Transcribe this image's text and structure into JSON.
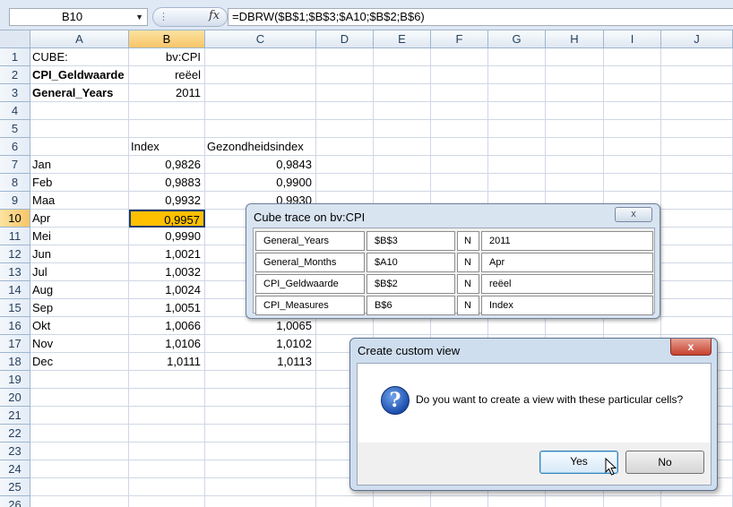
{
  "formula_bar": {
    "name_box": "B10",
    "fx_label": "fx",
    "formula": "=DBRW($B$1;$B$3;$A10;$B$2;B$6)"
  },
  "columns": [
    "A",
    "B",
    "C",
    "D",
    "E",
    "F",
    "G",
    "H",
    "I",
    "J"
  ],
  "rows": [
    {
      "n": "1",
      "a": "CUBE:",
      "b": "bv:CPI",
      "c": ""
    },
    {
      "n": "2",
      "a": "CPI_Geldwaarde",
      "b": "reëel",
      "c": ""
    },
    {
      "n": "3",
      "a": "General_Years",
      "b": "2011",
      "c": ""
    },
    {
      "n": "4",
      "a": "",
      "b": "",
      "c": ""
    },
    {
      "n": "5",
      "a": "",
      "b": "",
      "c": ""
    },
    {
      "n": "6",
      "a": "",
      "b": "Index",
      "c": "Gezondheidsindex"
    },
    {
      "n": "7",
      "a": "Jan",
      "b": "0,9826",
      "c": "0,9843"
    },
    {
      "n": "8",
      "a": "Feb",
      "b": "0,9883",
      "c": "0,9900"
    },
    {
      "n": "9",
      "a": "Maa",
      "b": "0,9932",
      "c": "0,9930"
    },
    {
      "n": "10",
      "a": "Apr",
      "b": "0,9957",
      "c": ""
    },
    {
      "n": "11",
      "a": "Mei",
      "b": "0,9990",
      "c": ""
    },
    {
      "n": "12",
      "a": "Jun",
      "b": "1,0021",
      "c": ""
    },
    {
      "n": "13",
      "a": "Jul",
      "b": "1,0032",
      "c": ""
    },
    {
      "n": "14",
      "a": "Aug",
      "b": "1,0024",
      "c": ""
    },
    {
      "n": "15",
      "a": "Sep",
      "b": "1,0051",
      "c": ""
    },
    {
      "n": "16",
      "a": "Okt",
      "b": "1,0066",
      "c": "1,0065"
    },
    {
      "n": "17",
      "a": "Nov",
      "b": "1,0106",
      "c": "1,0102"
    },
    {
      "n": "18",
      "a": "Dec",
      "b": "1,0111",
      "c": "1,0113"
    },
    {
      "n": "19",
      "a": "",
      "b": "",
      "c": ""
    },
    {
      "n": "20",
      "a": "",
      "b": "",
      "c": ""
    },
    {
      "n": "21",
      "a": "",
      "b": "",
      "c": ""
    },
    {
      "n": "22",
      "a": "",
      "b": "",
      "c": ""
    },
    {
      "n": "23",
      "a": "",
      "b": "",
      "c": ""
    },
    {
      "n": "24",
      "a": "",
      "b": "",
      "c": ""
    },
    {
      "n": "25",
      "a": "",
      "b": "",
      "c": ""
    },
    {
      "n": "26",
      "a": "",
      "b": "",
      "c": ""
    }
  ],
  "bold_rows": [
    "2",
    "3"
  ],
  "active_cell": {
    "row": "10",
    "col": "B"
  },
  "trace_window": {
    "title": "Cube trace on bv:CPI",
    "close_label": "x",
    "rows": [
      {
        "dim": "General_Years",
        "ref": "$B$3",
        "flag": "N",
        "value": "2011"
      },
      {
        "dim": "General_Months",
        "ref": "$A10",
        "flag": "N",
        "value": "Apr"
      },
      {
        "dim": "CPI_Geldwaarde",
        "ref": "$B$2",
        "flag": "N",
        "value": "reëel"
      },
      {
        "dim": "CPI_Measures",
        "ref": "B$6",
        "flag": "N",
        "value": "Index"
      }
    ]
  },
  "dialog": {
    "title": "Create custom view",
    "close_label": "x",
    "icon_glyph": "?",
    "message": "Do you want to create a view with these particular cells?",
    "yes_label": "Yes",
    "no_label": "No"
  },
  "colors": {
    "active_cell": "#ffc000",
    "header_selected": "#f8c569",
    "chrome": "#dfe8f5"
  }
}
